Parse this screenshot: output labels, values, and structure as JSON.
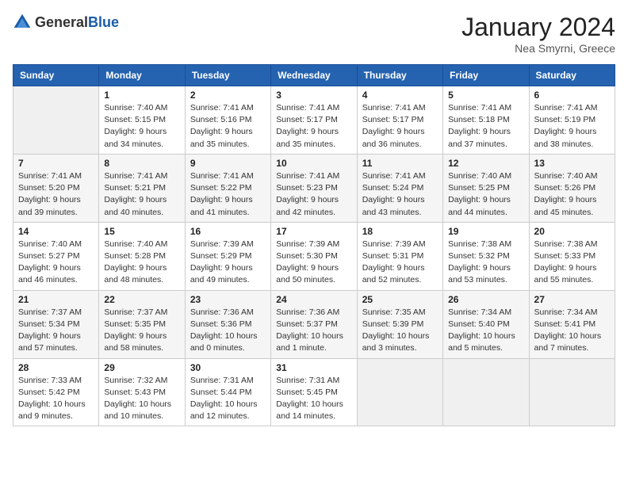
{
  "header": {
    "logo_general": "General",
    "logo_blue": "Blue",
    "month_title": "January 2024",
    "subtitle": "Nea Smyrni, Greece"
  },
  "weekdays": [
    "Sunday",
    "Monday",
    "Tuesday",
    "Wednesday",
    "Thursday",
    "Friday",
    "Saturday"
  ],
  "weeks": [
    [
      {
        "day": "",
        "sunrise": "",
        "sunset": "",
        "daylight": ""
      },
      {
        "day": "1",
        "sunrise": "Sunrise: 7:40 AM",
        "sunset": "Sunset: 5:15 PM",
        "daylight": "Daylight: 9 hours and 34 minutes."
      },
      {
        "day": "2",
        "sunrise": "Sunrise: 7:41 AM",
        "sunset": "Sunset: 5:16 PM",
        "daylight": "Daylight: 9 hours and 35 minutes."
      },
      {
        "day": "3",
        "sunrise": "Sunrise: 7:41 AM",
        "sunset": "Sunset: 5:17 PM",
        "daylight": "Daylight: 9 hours and 35 minutes."
      },
      {
        "day": "4",
        "sunrise": "Sunrise: 7:41 AM",
        "sunset": "Sunset: 5:17 PM",
        "daylight": "Daylight: 9 hours and 36 minutes."
      },
      {
        "day": "5",
        "sunrise": "Sunrise: 7:41 AM",
        "sunset": "Sunset: 5:18 PM",
        "daylight": "Daylight: 9 hours and 37 minutes."
      },
      {
        "day": "6",
        "sunrise": "Sunrise: 7:41 AM",
        "sunset": "Sunset: 5:19 PM",
        "daylight": "Daylight: 9 hours and 38 minutes."
      }
    ],
    [
      {
        "day": "7",
        "sunrise": "Sunrise: 7:41 AM",
        "sunset": "Sunset: 5:20 PM",
        "daylight": "Daylight: 9 hours and 39 minutes."
      },
      {
        "day": "8",
        "sunrise": "Sunrise: 7:41 AM",
        "sunset": "Sunset: 5:21 PM",
        "daylight": "Daylight: 9 hours and 40 minutes."
      },
      {
        "day": "9",
        "sunrise": "Sunrise: 7:41 AM",
        "sunset": "Sunset: 5:22 PM",
        "daylight": "Daylight: 9 hours and 41 minutes."
      },
      {
        "day": "10",
        "sunrise": "Sunrise: 7:41 AM",
        "sunset": "Sunset: 5:23 PM",
        "daylight": "Daylight: 9 hours and 42 minutes."
      },
      {
        "day": "11",
        "sunrise": "Sunrise: 7:41 AM",
        "sunset": "Sunset: 5:24 PM",
        "daylight": "Daylight: 9 hours and 43 minutes."
      },
      {
        "day": "12",
        "sunrise": "Sunrise: 7:40 AM",
        "sunset": "Sunset: 5:25 PM",
        "daylight": "Daylight: 9 hours and 44 minutes."
      },
      {
        "day": "13",
        "sunrise": "Sunrise: 7:40 AM",
        "sunset": "Sunset: 5:26 PM",
        "daylight": "Daylight: 9 hours and 45 minutes."
      }
    ],
    [
      {
        "day": "14",
        "sunrise": "Sunrise: 7:40 AM",
        "sunset": "Sunset: 5:27 PM",
        "daylight": "Daylight: 9 hours and 46 minutes."
      },
      {
        "day": "15",
        "sunrise": "Sunrise: 7:40 AM",
        "sunset": "Sunset: 5:28 PM",
        "daylight": "Daylight: 9 hours and 48 minutes."
      },
      {
        "day": "16",
        "sunrise": "Sunrise: 7:39 AM",
        "sunset": "Sunset: 5:29 PM",
        "daylight": "Daylight: 9 hours and 49 minutes."
      },
      {
        "day": "17",
        "sunrise": "Sunrise: 7:39 AM",
        "sunset": "Sunset: 5:30 PM",
        "daylight": "Daylight: 9 hours and 50 minutes."
      },
      {
        "day": "18",
        "sunrise": "Sunrise: 7:39 AM",
        "sunset": "Sunset: 5:31 PM",
        "daylight": "Daylight: 9 hours and 52 minutes."
      },
      {
        "day": "19",
        "sunrise": "Sunrise: 7:38 AM",
        "sunset": "Sunset: 5:32 PM",
        "daylight": "Daylight: 9 hours and 53 minutes."
      },
      {
        "day": "20",
        "sunrise": "Sunrise: 7:38 AM",
        "sunset": "Sunset: 5:33 PM",
        "daylight": "Daylight: 9 hours and 55 minutes."
      }
    ],
    [
      {
        "day": "21",
        "sunrise": "Sunrise: 7:37 AM",
        "sunset": "Sunset: 5:34 PM",
        "daylight": "Daylight: 9 hours and 57 minutes."
      },
      {
        "day": "22",
        "sunrise": "Sunrise: 7:37 AM",
        "sunset": "Sunset: 5:35 PM",
        "daylight": "Daylight: 9 hours and 58 minutes."
      },
      {
        "day": "23",
        "sunrise": "Sunrise: 7:36 AM",
        "sunset": "Sunset: 5:36 PM",
        "daylight": "Daylight: 10 hours and 0 minutes."
      },
      {
        "day": "24",
        "sunrise": "Sunrise: 7:36 AM",
        "sunset": "Sunset: 5:37 PM",
        "daylight": "Daylight: 10 hours and 1 minute."
      },
      {
        "day": "25",
        "sunrise": "Sunrise: 7:35 AM",
        "sunset": "Sunset: 5:39 PM",
        "daylight": "Daylight: 10 hours and 3 minutes."
      },
      {
        "day": "26",
        "sunrise": "Sunrise: 7:34 AM",
        "sunset": "Sunset: 5:40 PM",
        "daylight": "Daylight: 10 hours and 5 minutes."
      },
      {
        "day": "27",
        "sunrise": "Sunrise: 7:34 AM",
        "sunset": "Sunset: 5:41 PM",
        "daylight": "Daylight: 10 hours and 7 minutes."
      }
    ],
    [
      {
        "day": "28",
        "sunrise": "Sunrise: 7:33 AM",
        "sunset": "Sunset: 5:42 PM",
        "daylight": "Daylight: 10 hours and 9 minutes."
      },
      {
        "day": "29",
        "sunrise": "Sunrise: 7:32 AM",
        "sunset": "Sunset: 5:43 PM",
        "daylight": "Daylight: 10 hours and 10 minutes."
      },
      {
        "day": "30",
        "sunrise": "Sunrise: 7:31 AM",
        "sunset": "Sunset: 5:44 PM",
        "daylight": "Daylight: 10 hours and 12 minutes."
      },
      {
        "day": "31",
        "sunrise": "Sunrise: 7:31 AM",
        "sunset": "Sunset: 5:45 PM",
        "daylight": "Daylight: 10 hours and 14 minutes."
      },
      {
        "day": "",
        "sunrise": "",
        "sunset": "",
        "daylight": ""
      },
      {
        "day": "",
        "sunrise": "",
        "sunset": "",
        "daylight": ""
      },
      {
        "day": "",
        "sunrise": "",
        "sunset": "",
        "daylight": ""
      }
    ]
  ]
}
